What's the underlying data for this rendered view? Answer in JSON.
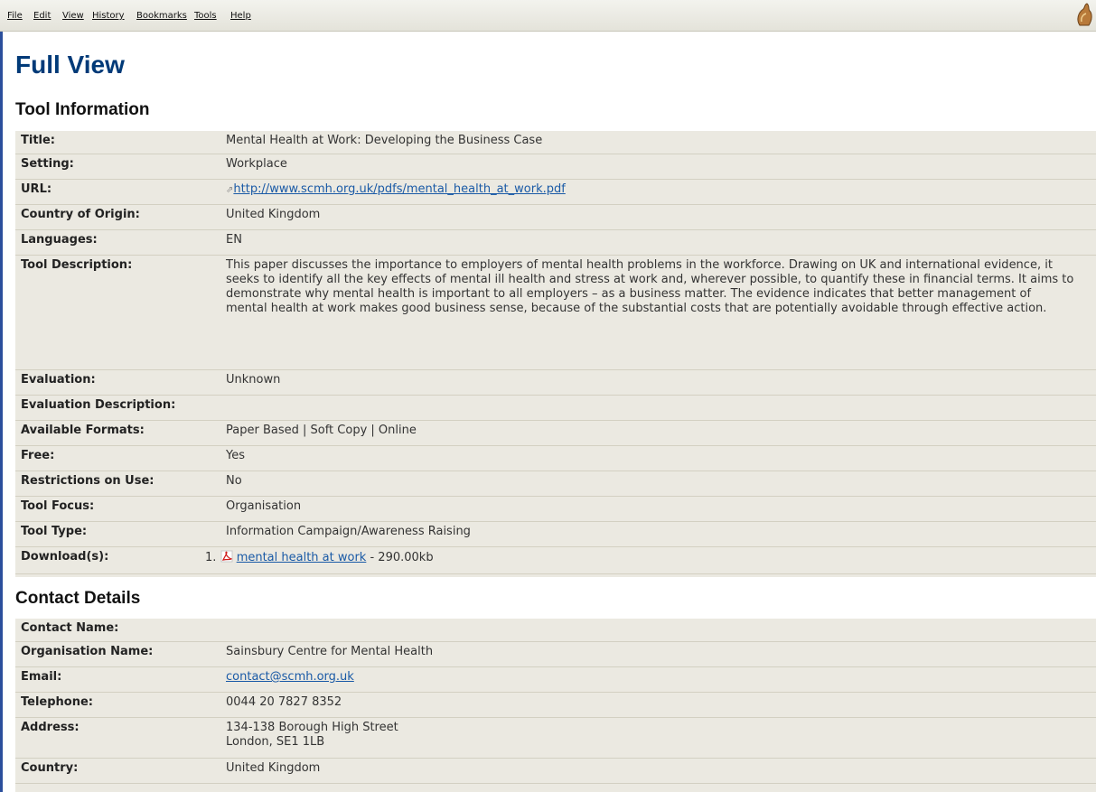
{
  "menu": [
    "File",
    "Edit",
    "View",
    "History",
    "Bookmarks",
    "Tools",
    "Help"
  ],
  "page_title": "Full View",
  "tool_info": {
    "heading": "Tool Information",
    "title_label": "Title:",
    "title_value": "Mental Health at Work: Developing the Business Case",
    "setting_label": "Setting:",
    "setting_value": "Workplace",
    "url_label": "URL:",
    "url_value": "http://www.scmh.org.uk/pdfs/mental_health_at_work.pdf",
    "country_label": "Country of Origin:",
    "country_value": "United Kingdom",
    "languages_label": "Languages:",
    "languages_value": "EN",
    "description_label": "Tool Description:",
    "description_value": "This paper discusses the importance to employers of mental health problems in the workforce. Drawing on UK and international evidence, it seeks to identify all the key effects of mental ill health and stress at work and, wherever possible, to quantify these in financial terms. It aims to demonstrate why mental health is important to all employers – as a business matter. The evidence indicates that better management of mental health at work makes good business sense, because of the substantial costs that are potentially avoidable through effective action.",
    "evaluation_label": "Evaluation:",
    "evaluation_value": "Unknown",
    "eval_desc_label": "Evaluation Description:",
    "eval_desc_value": "",
    "formats_label": "Available Formats:",
    "formats_value": "Paper Based | Soft Copy | Online",
    "free_label": "Free:",
    "free_value": "Yes",
    "restrictions_label": "Restrictions on Use:",
    "restrictions_value": "No",
    "focus_label": "Tool Focus:",
    "focus_value": "Organisation",
    "type_label": "Tool Type:",
    "type_value": "Information Campaign/Awareness Raising",
    "downloads_label": "Download(s):",
    "download_number": "1.",
    "download_link": "mental health at work",
    "download_size": "- 290.00kb"
  },
  "contact": {
    "heading": "Contact Details",
    "name_label": "Contact Name:",
    "name_value": "",
    "org_label": "Organisation Name:",
    "org_value": "Sainsbury Centre for Mental Health",
    "email_label": "Email:",
    "email_value": "contact@scmh.org.uk",
    "phone_label": "Telephone:",
    "phone_value": "0044 20 7827 8352",
    "address_label": "Address:",
    "address_line1": "134-138 Borough High Street",
    "address_line2": "London, SE1 1LB",
    "country_label": "Country:",
    "country_value": "United Kingdom"
  },
  "colors": {
    "title": "#003a78",
    "link": "#1a5aa6",
    "panel": "#ebe9e1",
    "menubar": "#e4e3da"
  },
  "icons": [
    "throbber-icon",
    "external-link-icon",
    "pdf-icon"
  ]
}
